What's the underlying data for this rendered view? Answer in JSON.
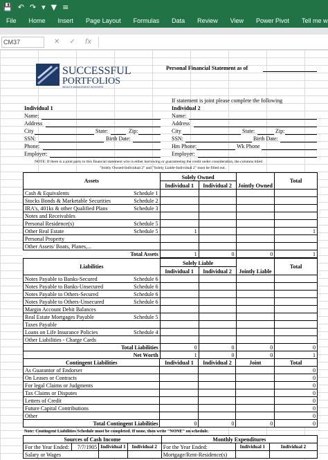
{
  "ribbon": {
    "tabs": [
      "File",
      "Home",
      "Insert",
      "Page Layout",
      "Formulas",
      "Data",
      "Review",
      "View",
      "Power Pivot",
      "Tell me what you"
    ]
  },
  "formula_bar": {
    "name_box": "CM37",
    "fx": "fx"
  },
  "logo": {
    "line1": "SUCCESSFUL",
    "line2": "PORTFOLIOS",
    "tagline": "WEALTH MANAGEMENT ADVISORS"
  },
  "header": {
    "title": "Personal Financial Statement as of",
    "joint_note": "If statement is joint please complete the following"
  },
  "individuals": {
    "ind1": "Individual 1",
    "ind2": "Individual 2",
    "name": "Name:",
    "address": "Address",
    "city": "City",
    "state": "State:",
    "zip": "Zip:",
    "ssn": "SSN:",
    "birth": "Birth Date:",
    "phone": "Phone:",
    "hm_phone": "Hm Phone:",
    "wk_phone": "Wk Phone",
    "employer": "Employer:"
  },
  "note": {
    "line1": "NOTE: If there is a joint party to this financial statement who is either borrowing or guaranteeing the credit under consideration, the columns titled",
    "line2": "\"Solely Owned-Individual 2\" and \"Solely Liable-Individual 2\" must be filled out."
  },
  "assets": {
    "header": "Assets",
    "solely": "Solely Owned",
    "ind1": "Individual 1",
    "ind2": "Individual 2",
    "jointly": "Jointly Owned",
    "total": "Total",
    "rows": [
      {
        "label": "Cash & Equivalents",
        "sch": "Schedule 1",
        "i1": "",
        "i2": "",
        "j": "",
        "t": ""
      },
      {
        "label": "Stocks Bonds & Marketable Securities",
        "sch": "Schedule 2",
        "i1": "",
        "i2": "",
        "j": "",
        "t": ""
      },
      {
        "label": "IRA's, 401ks & other Qualified Plans",
        "sch": "Schedule 3",
        "i1": "",
        "i2": "",
        "j": "",
        "t": ""
      },
      {
        "label": "Notes and Receivables",
        "sch": "",
        "i1": "",
        "i2": "",
        "j": "",
        "t": ""
      },
      {
        "label": "Personal Residence(s)",
        "sch": "Schedule 5",
        "i1": "",
        "i2": "",
        "j": "",
        "t": ""
      },
      {
        "label": "Other Real Estate",
        "sch": "Schedule 5",
        "i1": "1",
        "i2": "",
        "j": "",
        "t": "1"
      },
      {
        "label": "Personal Property",
        "sch": "",
        "i1": "",
        "i2": "",
        "j": "",
        "t": ""
      },
      {
        "label": "Other Assets/ Boats, Planes,...",
        "sch": "",
        "i1": "",
        "i2": "",
        "j": "",
        "t": ""
      }
    ],
    "total_label": "Total Assets",
    "total_values": [
      "1",
      "0",
      "0",
      "1"
    ]
  },
  "liabilities": {
    "header": "Liabilities",
    "solely": "Solely Liable",
    "ind1": "Individual 1",
    "ind2": "Individual 2",
    "jointly": "Jointly Liable",
    "total": "Total",
    "rows": [
      {
        "label": "Notes Payable to Banks-Secured",
        "sch": "Schedule 6",
        "i1": "",
        "i2": "",
        "j": "",
        "t": ""
      },
      {
        "label": "Notes Payable to Banks-Unsecured",
        "sch": "Schedule 6",
        "i1": "",
        "i2": "",
        "j": "",
        "t": ""
      },
      {
        "label": "Notes Payable to Others-Secured",
        "sch": "Schedule 6",
        "i1": "",
        "i2": "",
        "j": "",
        "t": ""
      },
      {
        "label": "Notes Payable to Others-Unsecured",
        "sch": "Schedule 6",
        "i1": "",
        "i2": "",
        "j": "",
        "t": ""
      },
      {
        "label": "Margin Account Debit Balances",
        "sch": "",
        "i1": "",
        "i2": "",
        "j": "",
        "t": ""
      },
      {
        "label": "Real Estate Mortgages Payable",
        "sch": "Schedule 5",
        "i1": "",
        "i2": "",
        "j": "",
        "t": ""
      },
      {
        "label": "Taxes Payable",
        "sch": "",
        "i1": "",
        "i2": "",
        "j": "",
        "t": ""
      },
      {
        "label": "Loans on Life Insurance Policies",
        "sch": "Schedule 4",
        "i1": "",
        "i2": "",
        "j": "",
        "t": ""
      },
      {
        "label": "Other Liabilities - Charge Cards",
        "sch": "",
        "i1": "",
        "i2": "",
        "j": "",
        "t": ""
      }
    ],
    "total_label": "Total Liabilities",
    "total_values": [
      "0",
      "0",
      "0",
      "0"
    ],
    "net_label": "Net Worth",
    "net_values": [
      "1",
      "0",
      "0",
      "1"
    ]
  },
  "contingent": {
    "header": "Contingent Liabilities",
    "ind1": "Individual 1",
    "ind2": "Individual 2",
    "joint": "Joint",
    "total": "Total",
    "rows": [
      {
        "label": "As Guarantor of Endorser",
        "t": "0"
      },
      {
        "label": "On Leases or Contracts",
        "t": "0"
      },
      {
        "label": "For legal Claims or Judgments",
        "t": "0"
      },
      {
        "label": "Tax Claims or Disputes",
        "t": "0"
      },
      {
        "label": "Letters of Credit",
        "t": "0"
      },
      {
        "label": "Future Capital Contributions",
        "t": "0"
      },
      {
        "label": "Other",
        "t": "0"
      }
    ],
    "total_label": "Total Contingent Liabilities",
    "total_values": [
      "0",
      "0",
      "0",
      "0"
    ]
  },
  "footer_note": "Note: Contingent Liabilities Schedule must be completed. If none, then write \"NONE\" on schedule.",
  "income": {
    "header": "Sources of Cash Income",
    "year_label": "For the Year Ended:",
    "year_value": "7/7/1905",
    "ind1": "Individual 1",
    "ind2": "Individual 2",
    "row1": "Salary or Wages"
  },
  "expenditures": {
    "header": "Monthly Expenditures",
    "year_label": "For the Year Ended:",
    "ind1": "Individual 1",
    "ind2": "Individual 2",
    "row1": "Mortgage/Rent-Residence(s)"
  },
  "colors": {
    "ribbon": "#217346",
    "logo_blue": "#1f3a66"
  }
}
